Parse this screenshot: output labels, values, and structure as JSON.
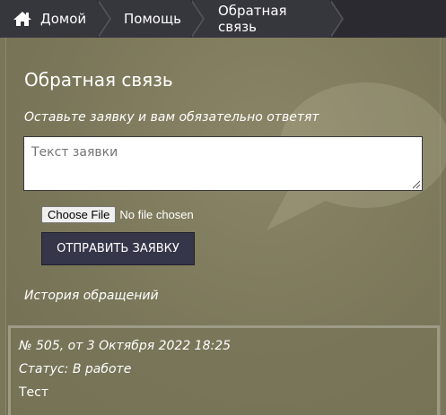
{
  "breadcrumb": {
    "items": [
      {
        "label": "Домой",
        "icon": "home-icon"
      },
      {
        "label": "Помощь"
      },
      {
        "label": "Обратная связь"
      }
    ]
  },
  "feedback": {
    "title": "Обратная связь",
    "subtitle": "Оставьте заявку и вам обязательно ответят",
    "textarea_placeholder": "Текст заявки",
    "file_button_label": "Choose File",
    "file_status": "No file chosen",
    "submit_label": "ОТПРАВИТЬ ЗАЯВКУ"
  },
  "history": {
    "title": "История обращений",
    "tickets": [
      {
        "header": "№ 505, от 3 Октября 2022 18:25",
        "status": "Статус: В работе",
        "text": "Тест"
      }
    ]
  },
  "colors": {
    "background": "#7a7659",
    "breadcrumb": "#36363d",
    "button": "#36364a"
  }
}
